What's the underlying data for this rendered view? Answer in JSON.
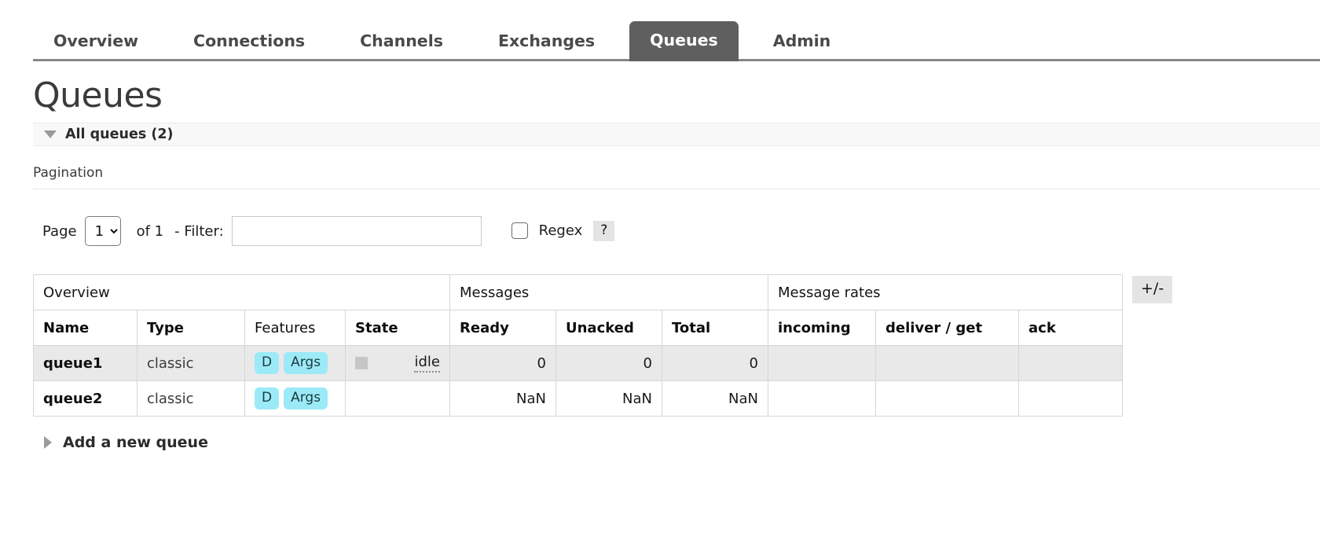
{
  "nav": {
    "tabs": [
      {
        "label": "Overview",
        "active": false
      },
      {
        "label": "Connections",
        "active": false
      },
      {
        "label": "Channels",
        "active": false
      },
      {
        "label": "Exchanges",
        "active": false
      },
      {
        "label": "Queues",
        "active": true
      },
      {
        "label": "Admin",
        "active": false
      }
    ]
  },
  "page": {
    "title": "Queues",
    "all_queues_label": "All queues (2)"
  },
  "pagination": {
    "heading": "Pagination",
    "page_label": "Page",
    "page_value": "1",
    "page_options": [
      "1"
    ],
    "of_label": "of 1",
    "filter_label": "- Filter:",
    "filter_value": "",
    "filter_placeholder": "",
    "regex_label": "Regex",
    "regex_checked": false,
    "help_label": "?"
  },
  "table": {
    "groups": [
      {
        "label": "Overview",
        "span": 4
      },
      {
        "label": "Messages",
        "span": 3
      },
      {
        "label": "Message rates",
        "span": 3
      }
    ],
    "columns": [
      {
        "label": "Name",
        "bold": true
      },
      {
        "label": "Type",
        "bold": true
      },
      {
        "label": "Features",
        "bold": false
      },
      {
        "label": "State",
        "bold": true
      },
      {
        "label": "Ready",
        "bold": true
      },
      {
        "label": "Unacked",
        "bold": true
      },
      {
        "label": "Total",
        "bold": true
      },
      {
        "label": "incoming",
        "bold": true
      },
      {
        "label": "deliver / get",
        "bold": true
      },
      {
        "label": "ack",
        "bold": true
      }
    ],
    "rows": [
      {
        "name": "queue1",
        "type": "classic",
        "features": [
          "D",
          "Args"
        ],
        "state": "idle",
        "state_indicator": true,
        "ready": "0",
        "unacked": "0",
        "total": "0",
        "incoming": "",
        "deliver_get": "",
        "ack": "",
        "shaded": true
      },
      {
        "name": "queue2",
        "type": "classic",
        "features": [
          "D",
          "Args"
        ],
        "state": "",
        "state_indicator": false,
        "ready": "NaN",
        "unacked": "NaN",
        "total": "NaN",
        "incoming": "",
        "deliver_get": "",
        "ack": "",
        "shaded": false
      }
    ],
    "toggle_columns_label": "+/-"
  },
  "footer": {
    "add_queue_label": "Add a new queue"
  },
  "colors": {
    "active_tab_bg": "#5f5f5f",
    "badge_bg": "#9ceaf7",
    "row_shaded": "#e9e9e9",
    "nav_rule": "#888888"
  }
}
